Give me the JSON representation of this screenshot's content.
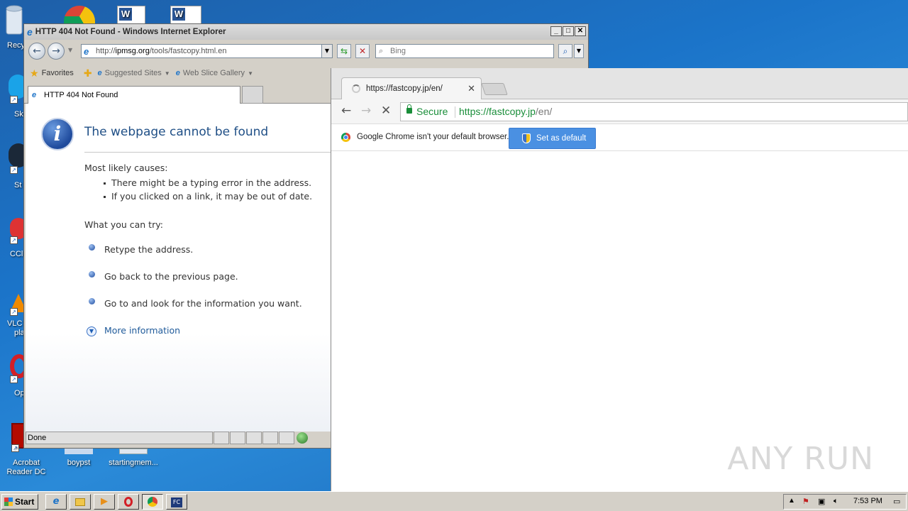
{
  "desktop": {
    "top_icon_label": "Recy",
    "left_labels": [
      "Sk",
      "St",
      "CCl",
      "VLC",
      "pla",
      "Op"
    ],
    "bottom_icons": [
      {
        "label": "Acrobat Reader DC"
      },
      {
        "label": "boypst"
      },
      {
        "label": "startingmem..."
      }
    ]
  },
  "ie": {
    "title": "HTTP 404 Not Found - Windows Internet Explorer",
    "address_prefix": "http://",
    "address_domain": "ipmsg.org",
    "address_path": "/tools/fastcopy.html.en",
    "search_placeholder": "Bing",
    "favorites_label": "Favorites",
    "suggested_sites_label": "Suggested Sites",
    "web_slice_label": "Web Slice Gallery",
    "tab_label": "HTTP 404 Not Found",
    "heading": "The webpage cannot be found",
    "causes_heading": "Most likely causes:",
    "causes": [
      "There might be a typing error in the address.",
      "If you clicked on a link, it may be out of date."
    ],
    "try_heading": "What you can try:",
    "try_items": [
      "Retype the address.",
      "Go back to the previous page.",
      "Go to  and look for the information you want."
    ],
    "more_info": "More information",
    "status_text": "Done"
  },
  "chrome": {
    "tab_title": "https://fastcopy.jp/en/",
    "secure_label": "Secure",
    "url_base": "https://fastcopy.jp",
    "url_path": "/en/",
    "infobar_text": "Google Chrome isn't your default browser.",
    "set_default_label": "Set as default"
  },
  "watermark": "ANY RUN",
  "taskbar": {
    "start_label": "Start",
    "clock": "7:53 PM"
  },
  "colors": {
    "desktop_blue": "#1b74c9",
    "ie_heading": "#1f4f86",
    "chrome_secure_green": "#1a8e3a",
    "set_default_blue": "#4a90e2"
  }
}
